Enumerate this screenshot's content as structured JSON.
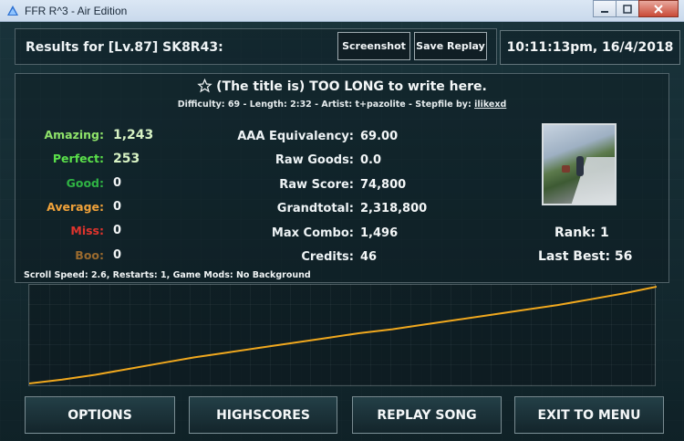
{
  "window": {
    "title": "FFR R^3 - Air Edition",
    "minimize_icon": "minimize-icon",
    "maximize_icon": "maximize-icon",
    "close_icon": "close-icon"
  },
  "header": {
    "results_title": "Results for [Lv.87] SK8R43:",
    "screenshot_label": "Screenshot",
    "save_replay_label": "Save Replay",
    "timestamp": "10:11:13pm, 16/4/2018"
  },
  "song": {
    "title": "(The title is) TOO LONG to write here.",
    "meta_prefix": "Difficulty: 69 - Length: 2:32 - Artist: t+pazolite - Stepfile by: ",
    "stepfile_author": "ilikexd",
    "favorite_icon": "star-outline-icon"
  },
  "judgements": [
    {
      "label": "Amazing:",
      "value": "1,243",
      "color": "#8fe36a"
    },
    {
      "label": "Perfect:",
      "value": "253",
      "color": "#5ae04a"
    },
    {
      "label": "Good:",
      "value": "0",
      "color": "#2fb344"
    },
    {
      "label": "Average:",
      "value": "0",
      "color": "#f0a23a"
    },
    {
      "label": "Miss:",
      "value": "0",
      "color": "#e0342d"
    },
    {
      "label": "Boo:",
      "value": "0",
      "color": "#9a6a2e"
    }
  ],
  "stats": [
    {
      "label": "AAA Equivalency:",
      "value": "69.00"
    },
    {
      "label": "Raw Goods:",
      "value": "0.0"
    },
    {
      "label": "Raw Score:",
      "value": "74,800"
    },
    {
      "label": "Grandtotal:",
      "value": "2,318,800"
    },
    {
      "label": "Max Combo:",
      "value": "1,496"
    },
    {
      "label": "Credits:",
      "value": "46"
    }
  ],
  "rank_text": "Rank: 1",
  "last_best_text": "Last Best: 56",
  "settings_line": "Scroll Speed: 2.6, Restarts: 1, Game Mods: No Background",
  "graph": {
    "line_color": "#f0a81e",
    "values": [
      0.0,
      0.04,
      0.09,
      0.15,
      0.21,
      0.27,
      0.32,
      0.37,
      0.42,
      0.47,
      0.52,
      0.56,
      0.61,
      0.66,
      0.71,
      0.76,
      0.81,
      0.87,
      0.93,
      1.0
    ]
  },
  "menu": {
    "options_label": "OPTIONS",
    "highscores_label": "HIGHSCORES",
    "replay_label": "REPLAY SONG",
    "exit_label": "EXIT TO MENU"
  }
}
